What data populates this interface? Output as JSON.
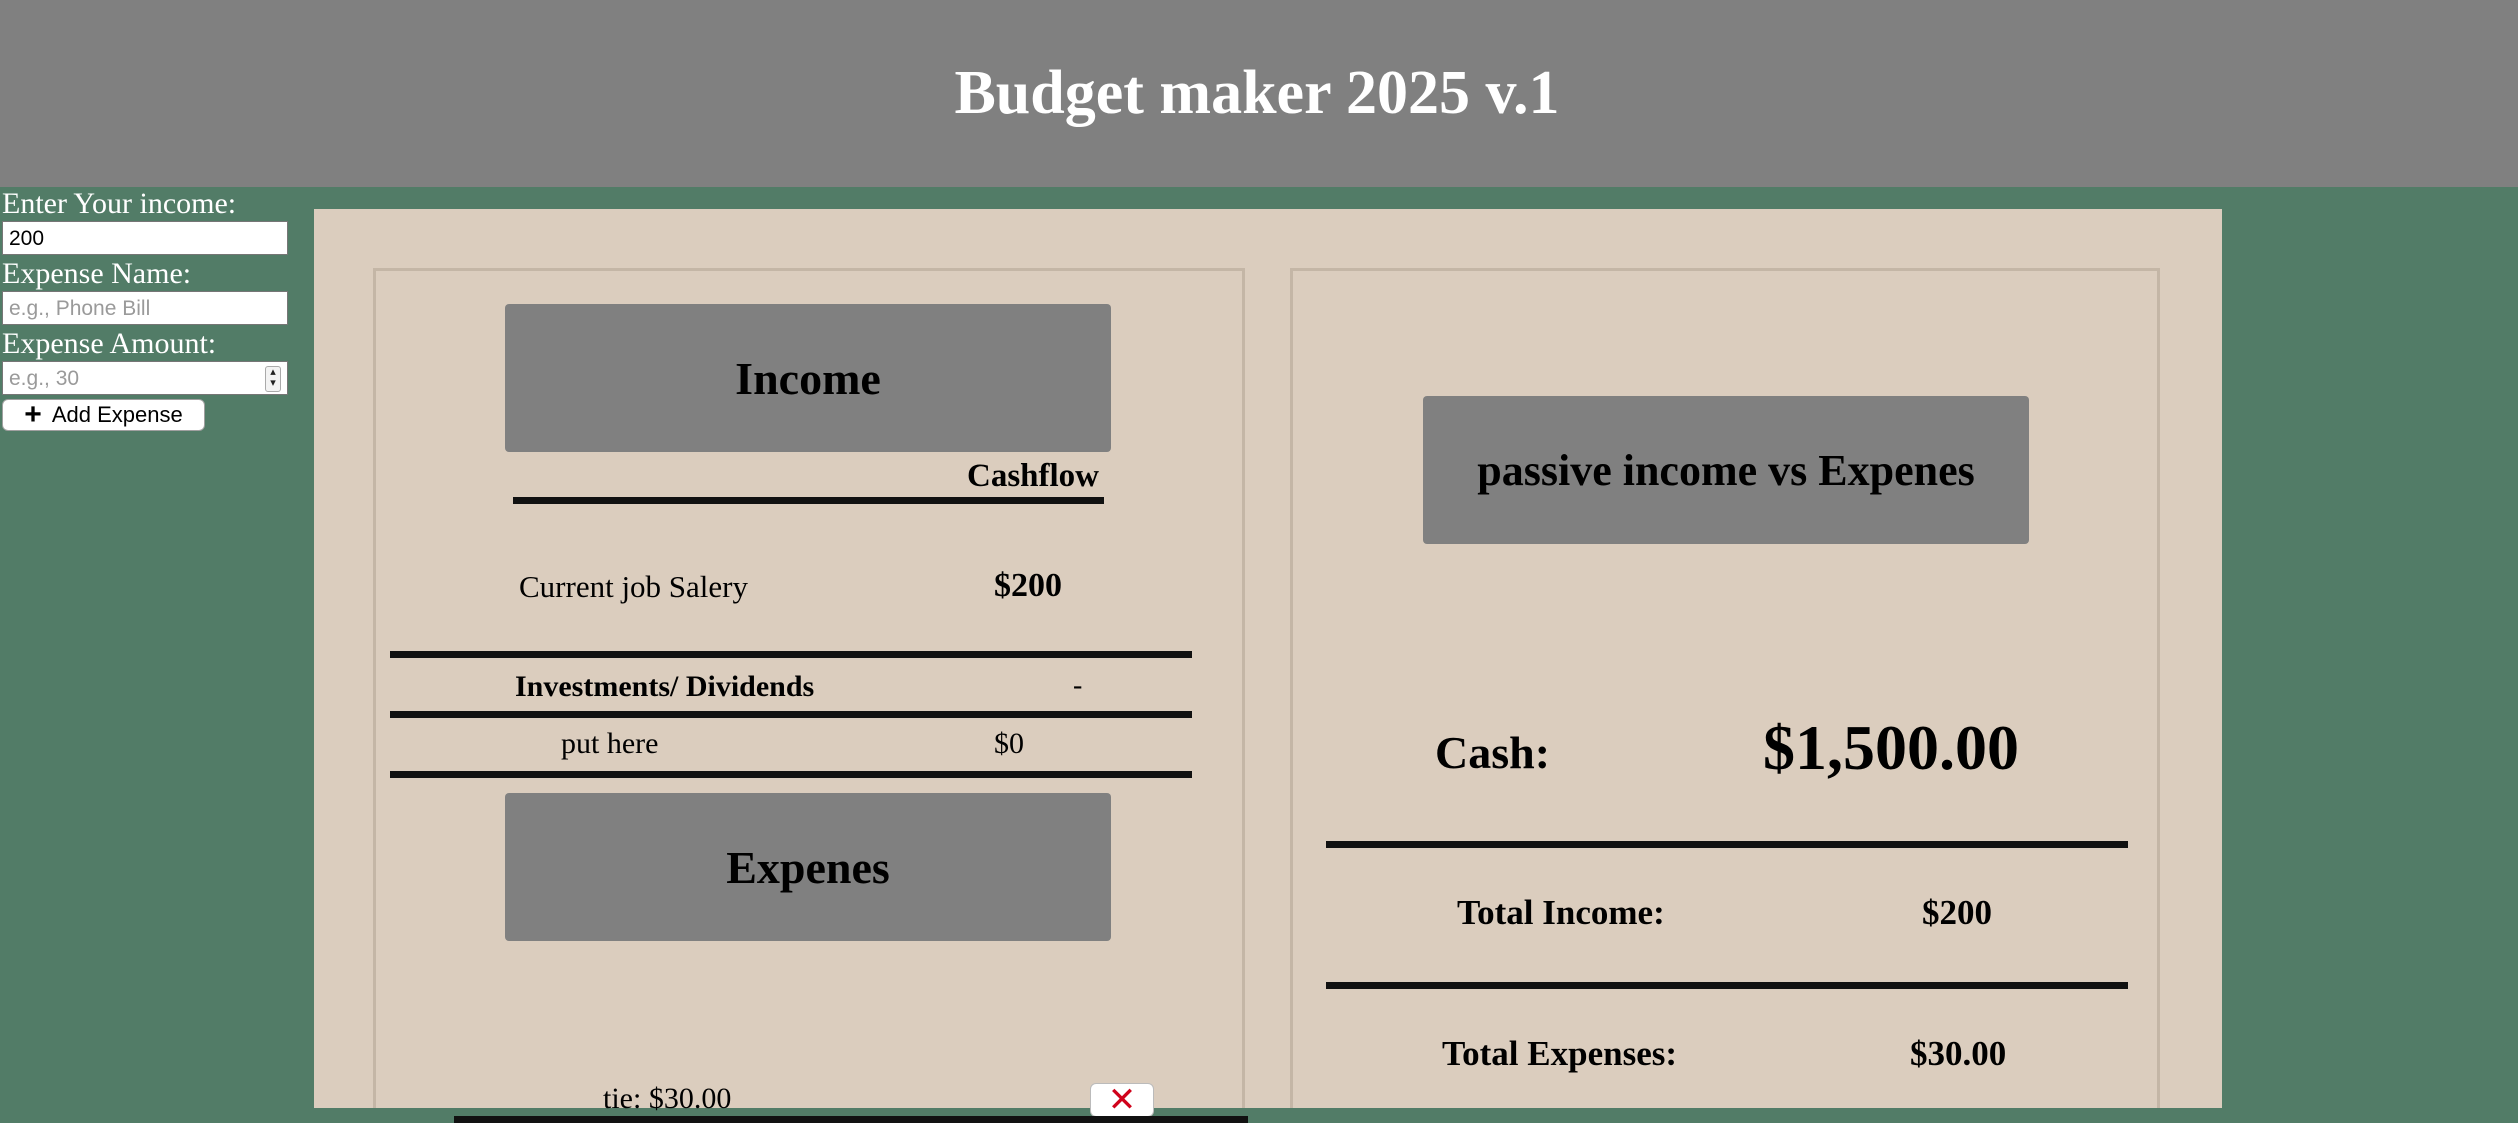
{
  "header": {
    "title": "Budget maker 2025 v.1"
  },
  "form": {
    "income_label": "Enter Your income:",
    "income_value": "200",
    "expense_name_label": "Expense Name:",
    "expense_name_placeholder": "e.g., Phone Bill",
    "expense_amount_label": "Expense Amount:",
    "expense_amount_placeholder": "e.g., 30",
    "add_button_label": "Add Expense"
  },
  "income_panel": {
    "title": "Income",
    "cashflow_label": "Cashflow",
    "job_label": "Current job Salery",
    "job_value": "$200",
    "investments_label": "Investments/ Dividends",
    "investments_value": "-",
    "put_here_label": "put here",
    "put_here_value": "$0",
    "expenses_title": "Expenes",
    "expenses": [
      {
        "text": "tie: $30.00"
      }
    ]
  },
  "summary_panel": {
    "title": "passive income vs Expenes",
    "cash_label": "Cash:",
    "cash_value": "$1,500.00",
    "total_income_label": "Total Income:",
    "total_income_value": "$200",
    "total_expenses_label": "Total Expenses:",
    "total_expenses_value": "$30.00"
  },
  "icons": {
    "add": "plus-icon",
    "delete": "close-x-icon"
  },
  "colors": {
    "background": "#527c67",
    "header": "#808080",
    "board": "#dbcdbe",
    "delete": "#d0021b"
  }
}
